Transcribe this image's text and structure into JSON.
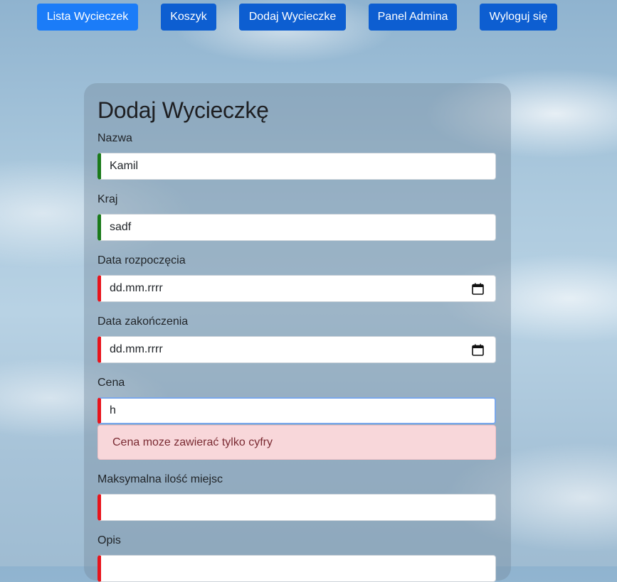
{
  "nav": {
    "items": [
      {
        "label": "Lista Wycieczek",
        "active": true
      },
      {
        "label": "Koszyk",
        "active": false
      },
      {
        "label": "Dodaj Wycieczke",
        "active": false
      },
      {
        "label": "Panel Admina",
        "active": false
      },
      {
        "label": "Wyloguj się",
        "active": false
      }
    ]
  },
  "form": {
    "title": "Dodaj Wycieczkę",
    "fields": {
      "nazwa": {
        "label": "Nazwa",
        "value": "Kamil",
        "state": "valid"
      },
      "kraj": {
        "label": "Kraj",
        "value": "sadf",
        "state": "valid"
      },
      "data_rozpoczecia": {
        "label": "Data rozpoczęcia",
        "value": "dd.mm.rrrr",
        "state": "invalid"
      },
      "data_zakonczenia": {
        "label": "Data zakończenia",
        "value": "dd.mm.rrrr",
        "state": "invalid"
      },
      "cena": {
        "label": "Cena",
        "value": "h",
        "state": "invalid",
        "error": "Cena moze zawierać tylko cyfry"
      },
      "max_miejsc": {
        "label": "Maksymalna ilość miejsc",
        "value": "",
        "state": "invalid"
      },
      "opis": {
        "label": "Opis",
        "value": "",
        "state": "invalid"
      }
    }
  },
  "colors": {
    "nav_button": "#0d5ed1",
    "nav_button_active": "#1b7cf8",
    "valid_border": "#1a7a1a",
    "invalid_border": "#e8141c",
    "alert_bg": "#f8d7da",
    "alert_text": "#7a2a32"
  },
  "icons": {
    "date_picker": "calendar-icon"
  }
}
